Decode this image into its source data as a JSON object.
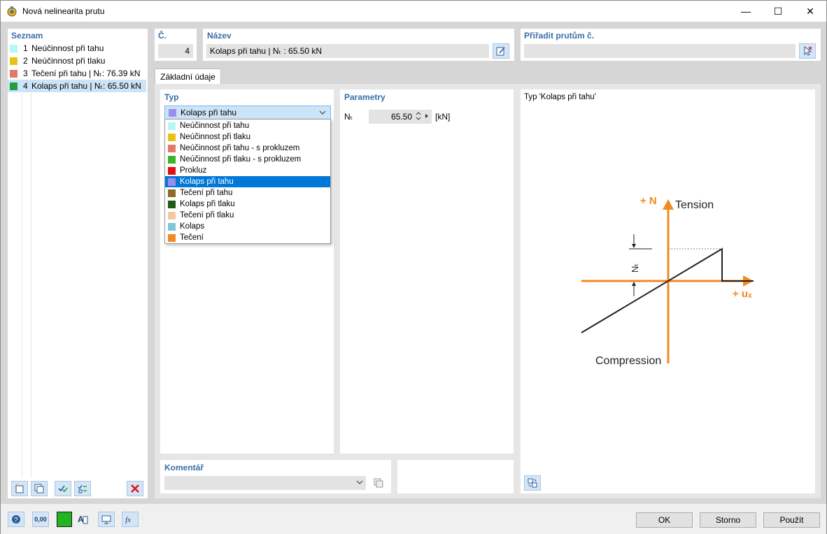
{
  "window": {
    "title": "Nová nelinearita prutu",
    "minimize": "—",
    "maximize": "☐",
    "close": "✕"
  },
  "list": {
    "header": "Seznam",
    "items": [
      {
        "num": "1",
        "label": "Neúčinnost při tahu",
        "color": "#b3f7f7"
      },
      {
        "num": "2",
        "label": "Neúčinnost při tlaku",
        "color": "#e8c21a"
      },
      {
        "num": "3",
        "label": "Tečení při tahu | Nₜ: 76.39 kN",
        "color": "#e07a6a"
      },
      {
        "num": "4",
        "label": "Kolaps při tahu | Nₜ: 65.50 kN",
        "color": "#22a040"
      }
    ]
  },
  "no": {
    "header": "Č.",
    "value": "4"
  },
  "name": {
    "header": "Název",
    "value": "Kolaps při tahu | Nₜ : 65.50 kN"
  },
  "assign": {
    "header": "Přiřadit prutům č.",
    "value": ""
  },
  "tab": {
    "label": "Základní údaje"
  },
  "type": {
    "header": "Typ",
    "selected": "Kolaps při tahu",
    "selected_color": "#9b8cf0",
    "options": [
      {
        "label": "Neúčinnost při tahu",
        "color": "#b3f7f7"
      },
      {
        "label": "Neúčinnost při tlaku",
        "color": "#e8c21a"
      },
      {
        "label": "Neúčinnost při tahu - s prokluzem",
        "color": "#e07a6a"
      },
      {
        "label": "Neúčinnost při tlaku - s prokluzem",
        "color": "#3bb52c"
      },
      {
        "label": "Prokluz",
        "color": "#e21010"
      },
      {
        "label": "Kolaps při tahu",
        "color": "#9b8cf0"
      },
      {
        "label": "Tečení při tahu",
        "color": "#8c6a2a"
      },
      {
        "label": "Kolaps při tlaku",
        "color": "#1e5c14"
      },
      {
        "label": "Tečení při tlaku",
        "color": "#f2c9a0"
      },
      {
        "label": "Kolaps",
        "color": "#7ec8d8"
      },
      {
        "label": "Tečení",
        "color": "#f28a22"
      }
    ]
  },
  "params": {
    "header": "Parametry",
    "nt_label": "Nₜ",
    "nt_value": "65.50",
    "nt_unit": "[kN]"
  },
  "diagram": {
    "header": "Typ 'Kolaps při tahu'",
    "n_label": "+ N",
    "tension": "Tension",
    "compression": "Compression",
    "ux_label": "+ uₓ",
    "nt_label": "Nₜ",
    "axis_color": "#f28a22"
  },
  "comment": {
    "header": "Komentář",
    "value": ""
  },
  "buttons": {
    "ok": "OK",
    "cancel": "Storno",
    "apply": "Použít"
  },
  "bottom_value": "0,00"
}
